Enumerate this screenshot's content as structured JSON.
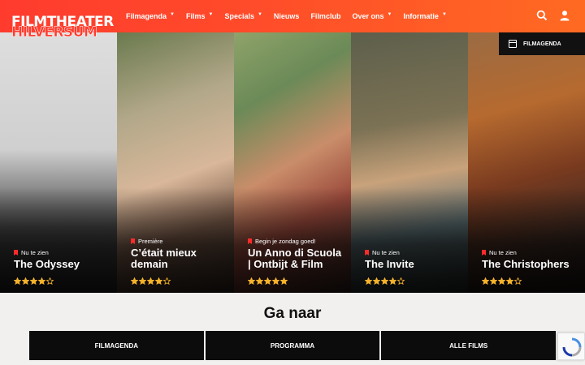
{
  "header": {
    "logo_line1": "FILMTHEATER",
    "logo_line2": "HILVERSUM",
    "nav": [
      {
        "label": "Filmagenda",
        "has_caret": true
      },
      {
        "label": "Films",
        "has_caret": true
      },
      {
        "label": "Specials",
        "has_caret": true
      },
      {
        "label": "Nieuws",
        "has_caret": false
      },
      {
        "label": "Filmclub",
        "has_caret": false
      },
      {
        "label": "Over ons",
        "has_caret": true
      },
      {
        "label": "Informatie",
        "has_caret": true
      }
    ],
    "icons": [
      "search-icon",
      "user-icon"
    ]
  },
  "filmagenda_tab": "FILMAGENDA",
  "films": [
    {
      "status": "Nu te zien",
      "title": "The Odyssey",
      "rating": 4,
      "max_rating": 5
    },
    {
      "status": "Première",
      "title": "C’était mieux demain",
      "rating": 4,
      "max_rating": 5
    },
    {
      "status": "Begin je zondag goed!",
      "title": "Un Anno di Scuola | Ontbijt & Film",
      "rating": 5,
      "max_rating": 5
    },
    {
      "status": "Nu te zien",
      "title": "The Invite",
      "rating": 4,
      "max_rating": 5
    },
    {
      "status": "Nu te zien",
      "title": "The Christophers",
      "rating": 4,
      "max_rating": 5
    }
  ],
  "goto": {
    "heading": "Ga naar",
    "buttons": [
      "FILMAGENDA",
      "PROGRAMMA",
      "ALLE FILMS"
    ]
  },
  "colors": {
    "brand": "#ff3b2e",
    "star": "#f5b22a",
    "bookmark": "#ff2b2b"
  }
}
